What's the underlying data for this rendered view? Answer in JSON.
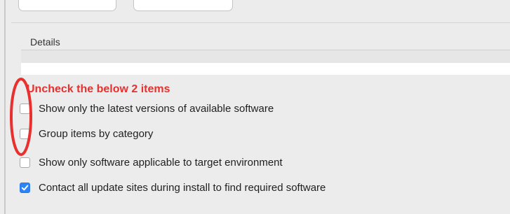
{
  "annotation": {
    "text": "Uncheck the below 2 items",
    "color": "#e8302f"
  },
  "details": {
    "label": "Details",
    "value": ""
  },
  "options": [
    {
      "label": "Show only the latest versions of available software",
      "checked": false
    },
    {
      "label": "Group items by category",
      "checked": false
    },
    {
      "label": "Show only software applicable to target environment",
      "checked": false
    },
    {
      "label": "Contact all update sites during install to find required software",
      "checked": true
    }
  ],
  "colors": {
    "accent": "#2d83f5",
    "annotation": "#e8302f",
    "background": "#ececec"
  },
  "icons": {
    "checkmark": "checkmark-icon",
    "highlight": "red-ellipse-annotation"
  }
}
